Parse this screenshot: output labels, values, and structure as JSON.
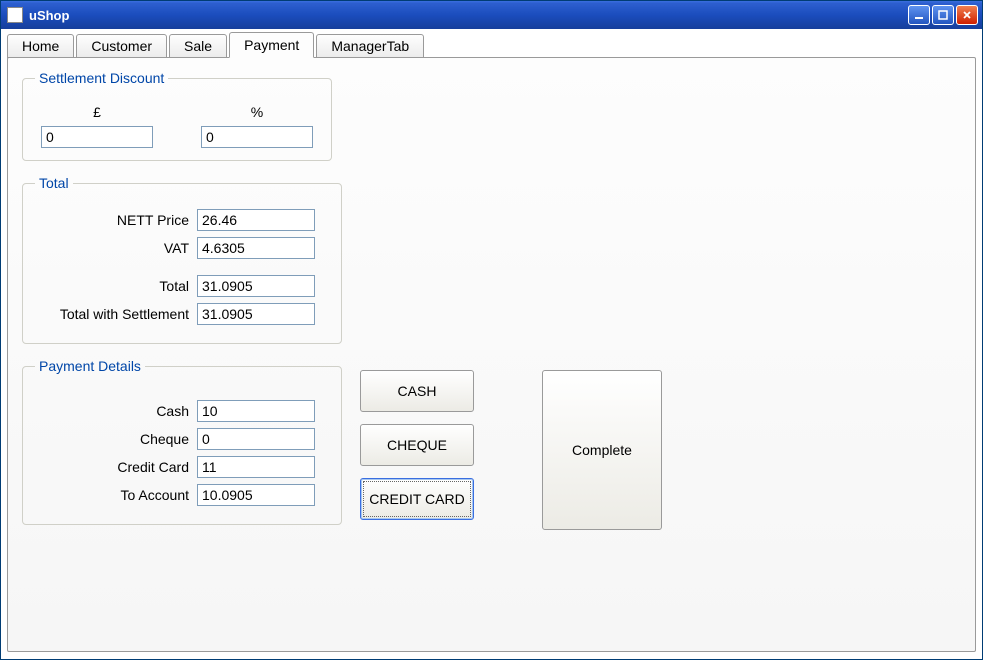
{
  "window": {
    "title": "uShop"
  },
  "tabs": {
    "home": "Home",
    "customer": "Customer",
    "sale": "Sale",
    "payment": "Payment",
    "manager": "ManagerTab"
  },
  "settlement": {
    "legend": "Settlement Discount",
    "pound_label": "£",
    "pound_value": "0",
    "percent_label": "%",
    "percent_value": "0"
  },
  "total": {
    "legend": "Total",
    "nett_label": "NETT Price",
    "nett_value": "26.46",
    "vat_label": "VAT",
    "vat_value": "4.6305",
    "total_label": "Total",
    "total_value": "31.0905",
    "settle_label": "Total with Settlement",
    "settle_value": "31.0905"
  },
  "payment": {
    "legend": "Payment Details",
    "cash_label": "Cash",
    "cash_value": "10",
    "cheque_label": "Cheque",
    "cheque_value": "0",
    "cc_label": "Credit Card",
    "cc_value": "11",
    "account_label": "To Account",
    "account_value": "10.0905"
  },
  "buttons": {
    "cash": "CASH",
    "cheque": "CHEQUE",
    "credit_card": "CREDIT CARD",
    "complete": "Complete"
  }
}
